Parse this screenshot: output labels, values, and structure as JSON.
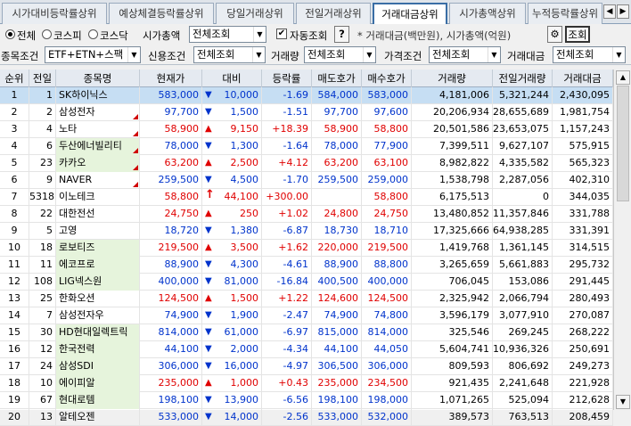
{
  "tabs": [
    {
      "label": "시가대비등락률상위",
      "active": false
    },
    {
      "label": "예상체결등락률상위",
      "active": false
    },
    {
      "label": "당일거래상위",
      "active": false
    },
    {
      "label": "전일거래상위",
      "active": false
    },
    {
      "label": "거래대금상위",
      "active": true
    },
    {
      "label": "시가총액상위",
      "active": false
    },
    {
      "label": "누적등락률상위",
      "active": false
    }
  ],
  "tab_prev": "◀",
  "tab_next": "▶",
  "filters": {
    "market_all": "전체",
    "market_kospi": "코스피",
    "market_kosdaq": "코스닥",
    "mcap_label": "시가총액",
    "mcap_value": "전체조회",
    "auto_check": "✔",
    "auto_label": "자동조회",
    "help_label": "?",
    "note": "* 거래대금(백만원), 시가총액(억원)",
    "search_label": "조회",
    "item_cond_label": "종목조건",
    "item_cond_value": "ETF+ETN+스팩",
    "credit_label": "신용조건",
    "credit_value": "전체조회",
    "volume_label": "거래량",
    "volume_value": "전체조회",
    "price_label": "가격조건",
    "price_value": "전체조회",
    "amount_label": "거래대금",
    "amount_value": "전체조회"
  },
  "columns": [
    "순위",
    "전일",
    "종목명",
    "현재가",
    "대비",
    "등락률",
    "매도호가",
    "매수호가",
    "거래량",
    "전일거래량",
    "거래대금"
  ],
  "rows": [
    {
      "rank": "1",
      "prev": "1",
      "name": "SK하이닉스",
      "price": "583,000",
      "dir": "down",
      "change": "10,000",
      "rate": "-1.69",
      "ask": "584,000",
      "bid": "583,000",
      "vol": "4,181,006",
      "pvol": "5,321,244",
      "amt": "2,430,095",
      "flag": false,
      "selected": true,
      "hl": false
    },
    {
      "rank": "2",
      "prev": "2",
      "name": "삼성전자",
      "price": "97,700",
      "dir": "down",
      "change": "1,500",
      "rate": "-1.51",
      "ask": "97,700",
      "bid": "97,600",
      "vol": "20,206,934",
      "pvol": "28,655,689",
      "amt": "1,981,754",
      "flag": true,
      "selected": false,
      "hl": false
    },
    {
      "rank": "3",
      "prev": "4",
      "name": "노타",
      "price": "58,900",
      "dir": "up",
      "change": "9,150",
      "rate": "+18.39",
      "ask": "58,900",
      "bid": "58,800",
      "vol": "20,501,586",
      "pvol": "23,653,075",
      "amt": "1,157,243",
      "flag": true,
      "selected": false,
      "hl": false
    },
    {
      "rank": "4",
      "prev": "6",
      "name": "두산에너빌리티",
      "price": "78,000",
      "dir": "down",
      "change": "1,300",
      "rate": "-1.64",
      "ask": "78,000",
      "bid": "77,900",
      "vol": "7,399,511",
      "pvol": "9,627,107",
      "amt": "575,915",
      "flag": true,
      "selected": false,
      "hl": true
    },
    {
      "rank": "5",
      "prev": "23",
      "name": "카카오",
      "price": "63,200",
      "dir": "up",
      "change": "2,500",
      "rate": "+4.12",
      "ask": "63,200",
      "bid": "63,100",
      "vol": "8,982,822",
      "pvol": "4,335,582",
      "amt": "565,323",
      "flag": true,
      "selected": false,
      "hl": true
    },
    {
      "rank": "6",
      "prev": "9",
      "name": "NAVER",
      "price": "259,500",
      "dir": "down",
      "change": "4,500",
      "rate": "-1.70",
      "ask": "259,500",
      "bid": "259,000",
      "vol": "1,538,798",
      "pvol": "2,287,056",
      "amt": "402,310",
      "flag": true,
      "selected": false,
      "hl": false
    },
    {
      "rank": "7",
      "prev": "5318",
      "name": "이노테크",
      "price": "58,800",
      "dir": "uparrow",
      "change": "44,100",
      "rate": "+300.00",
      "ask": "",
      "bid": "58,800",
      "vol": "6,175,513",
      "pvol": "0",
      "amt": "344,035",
      "flag": false,
      "selected": false,
      "hl": false
    },
    {
      "rank": "8",
      "prev": "22",
      "name": "대한전선",
      "price": "24,750",
      "dir": "up",
      "change": "250",
      "rate": "+1.02",
      "ask": "24,800",
      "bid": "24,750",
      "vol": "13,480,852",
      "pvol": "11,357,846",
      "amt": "331,788",
      "flag": false,
      "selected": false,
      "hl": false
    },
    {
      "rank": "9",
      "prev": "5",
      "name": "고영",
      "price": "18,720",
      "dir": "down",
      "change": "1,380",
      "rate": "-6.87",
      "ask": "18,730",
      "bid": "18,710",
      "vol": "17,325,666",
      "pvol": "64,938,285",
      "amt": "331,391",
      "flag": false,
      "selected": false,
      "hl": false
    },
    {
      "rank": "10",
      "prev": "18",
      "name": "로보티즈",
      "price": "219,500",
      "dir": "up",
      "change": "3,500",
      "rate": "+1.62",
      "ask": "220,000",
      "bid": "219,500",
      "vol": "1,419,768",
      "pvol": "1,361,145",
      "amt": "314,515",
      "flag": false,
      "selected": false,
      "hl": true
    },
    {
      "rank": "11",
      "prev": "11",
      "name": "에코프로",
      "price": "88,900",
      "dir": "down",
      "change": "4,300",
      "rate": "-4.61",
      "ask": "88,900",
      "bid": "88,800",
      "vol": "3,265,659",
      "pvol": "5,661,883",
      "amt": "295,732",
      "flag": false,
      "selected": false,
      "hl": true
    },
    {
      "rank": "12",
      "prev": "108",
      "name": "LIG넥스원",
      "price": "400,000",
      "dir": "down",
      "change": "81,000",
      "rate": "-16.84",
      "ask": "400,500",
      "bid": "400,000",
      "vol": "706,045",
      "pvol": "153,086",
      "amt": "291,445",
      "flag": false,
      "selected": false,
      "hl": true
    },
    {
      "rank": "13",
      "prev": "25",
      "name": "한화오션",
      "price": "124,500",
      "dir": "up",
      "change": "1,500",
      "rate": "+1.22",
      "ask": "124,600",
      "bid": "124,500",
      "vol": "2,325,942",
      "pvol": "2,066,794",
      "amt": "280,493",
      "flag": false,
      "selected": false,
      "hl": false
    },
    {
      "rank": "14",
      "prev": "7",
      "name": "삼성전자우",
      "price": "74,900",
      "dir": "down",
      "change": "1,900",
      "rate": "-2.47",
      "ask": "74,900",
      "bid": "74,800",
      "vol": "3,596,179",
      "pvol": "3,077,910",
      "amt": "270,087",
      "flag": false,
      "selected": false,
      "hl": false
    },
    {
      "rank": "15",
      "prev": "30",
      "name": "HD현대일렉트릭",
      "price": "814,000",
      "dir": "down",
      "change": "61,000",
      "rate": "-6.97",
      "ask": "815,000",
      "bid": "814,000",
      "vol": "325,546",
      "pvol": "269,245",
      "amt": "268,222",
      "flag": false,
      "selected": false,
      "hl": true
    },
    {
      "rank": "16",
      "prev": "12",
      "name": "한국전력",
      "price": "44,100",
      "dir": "down",
      "change": "2,000",
      "rate": "-4.34",
      "ask": "44,100",
      "bid": "44,050",
      "vol": "5,604,741",
      "pvol": "10,936,326",
      "amt": "250,691",
      "flag": false,
      "selected": false,
      "hl": true
    },
    {
      "rank": "17",
      "prev": "24",
      "name": "삼성SDI",
      "price": "306,000",
      "dir": "down",
      "change": "16,000",
      "rate": "-4.97",
      "ask": "306,500",
      "bid": "306,000",
      "vol": "809,593",
      "pvol": "806,692",
      "amt": "249,273",
      "flag": false,
      "selected": false,
      "hl": true
    },
    {
      "rank": "18",
      "prev": "10",
      "name": "에이피알",
      "price": "235,000",
      "dir": "up",
      "change": "1,000",
      "rate": "+0.43",
      "ask": "235,000",
      "bid": "234,500",
      "vol": "921,435",
      "pvol": "2,241,648",
      "amt": "221,928",
      "flag": false,
      "selected": false,
      "hl": true
    },
    {
      "rank": "19",
      "prev": "67",
      "name": "현대로템",
      "price": "198,100",
      "dir": "down",
      "change": "13,900",
      "rate": "-6.56",
      "ask": "198,100",
      "bid": "198,000",
      "vol": "1,071,265",
      "pvol": "525,094",
      "amt": "212,628",
      "flag": false,
      "selected": false,
      "hl": true
    },
    {
      "rank": "20",
      "prev": "13",
      "name": "알테오젠",
      "price": "533,000",
      "dir": "down",
      "change": "14,000",
      "rate": "-2.56",
      "ask": "533,000",
      "bid": "532,000",
      "vol": "389,573",
      "pvol": "763,513",
      "amt": "208,459",
      "flag": false,
      "selected": false,
      "hl": false
    }
  ],
  "colors": {
    "up": "#e00000",
    "down": "#0033cc",
    "selected_row": "#c6def3",
    "highlight_cell": "#e6f4dc",
    "active_tab_border": "#3a6ea5"
  }
}
